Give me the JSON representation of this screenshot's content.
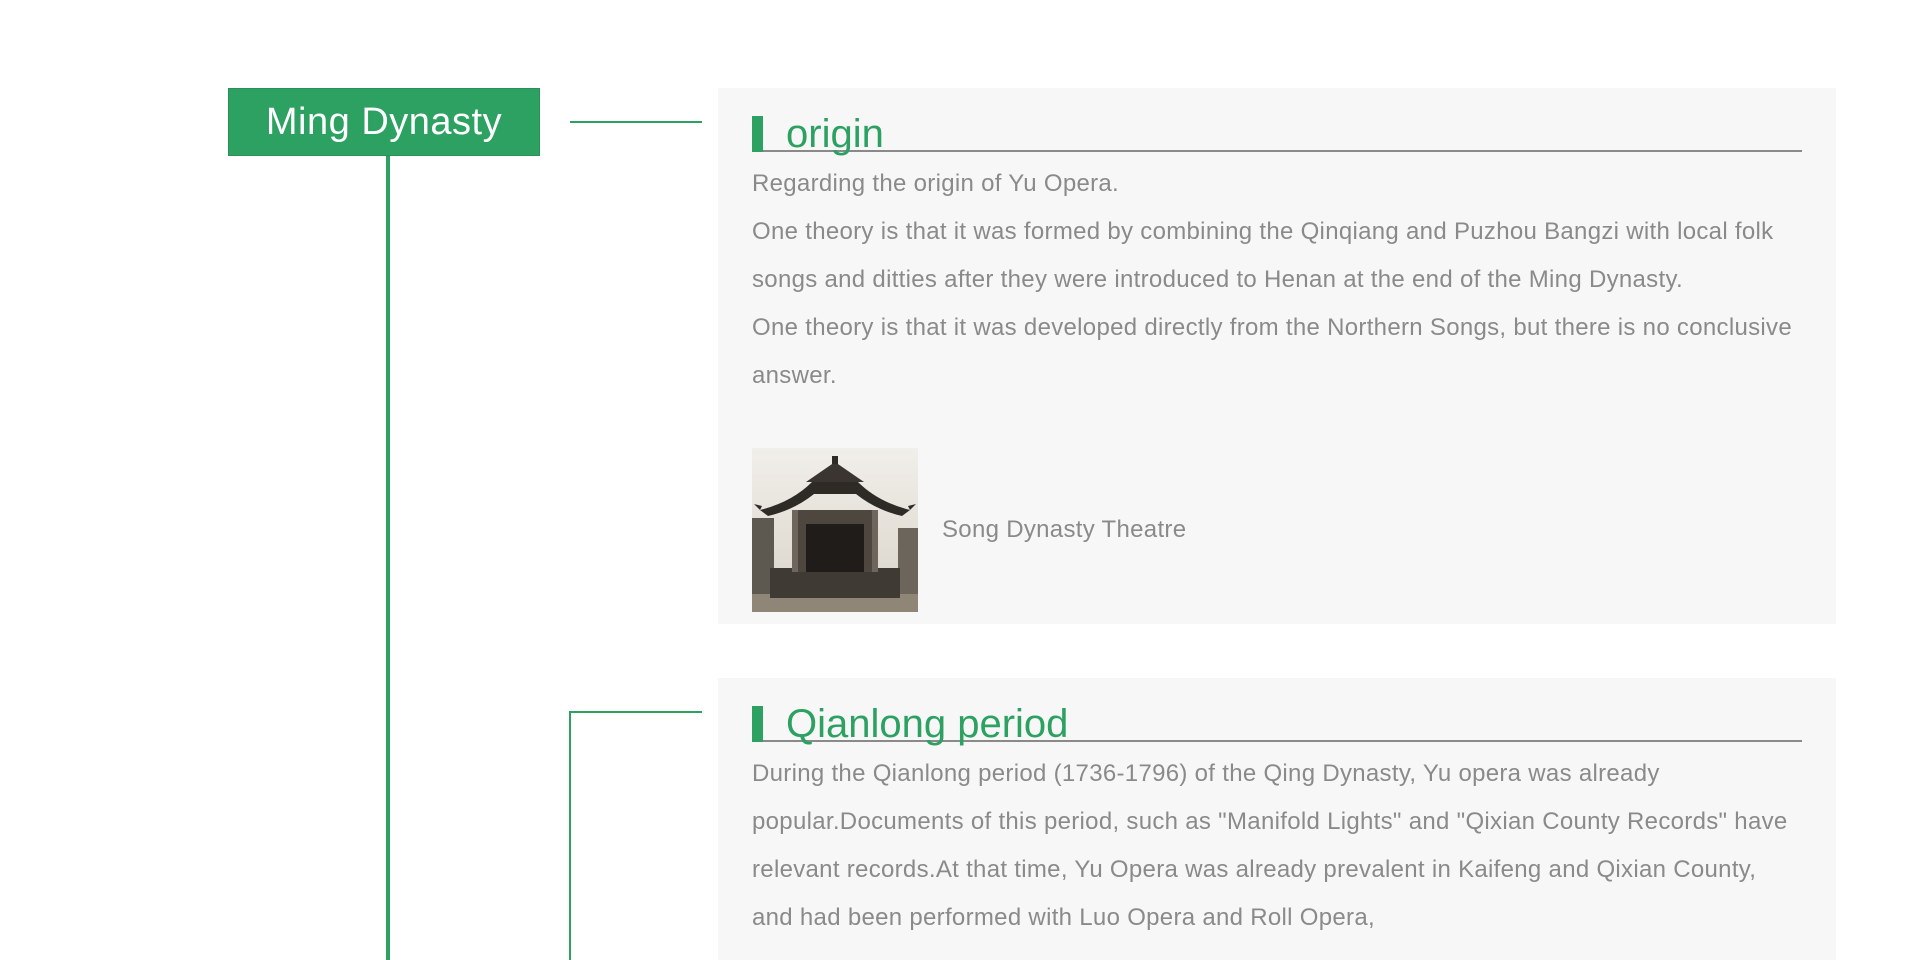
{
  "dynasty": {
    "label": "Ming Dynasty"
  },
  "sections": [
    {
      "title": "origin",
      "paragraphs": [
        "Regarding the origin of Yu Opera.",
        "One theory is that it was formed by combining the Qinqiang and Puzhou Bangzi with local folk songs and ditties after they were introduced to Henan at the end of the Ming Dynasty.",
        "One theory is that it was developed directly from the Northern Songs, but there is no conclusive answer."
      ],
      "figure": {
        "caption": "Song Dynasty Theatre",
        "icon": "pavilion-photo"
      }
    },
    {
      "title": "Qianlong period",
      "paragraphs": [
        "During the Qianlong period (1736-1796) of the Qing Dynasty, Yu opera was already popular.Documents of this period, such as \"Manifold Lights\" and \"Qixian County Records\" have relevant records.At that time, Yu Opera was already prevalent in Kaifeng and Qixian County, and had been performed with Luo Opera and Roll Opera,"
      ]
    }
  ],
  "colors": {
    "accent": "#2ca162",
    "panel": "#f7f7f7",
    "text": "#8a8a8a"
  }
}
